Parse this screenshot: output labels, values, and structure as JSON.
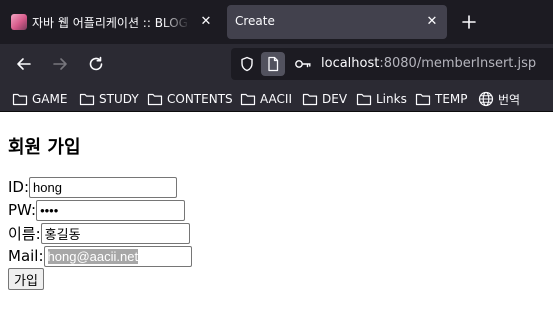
{
  "browser": {
    "tabs": [
      {
        "title": "자바 웹 어플리케이션 :: BLOG.AACII.NET",
        "active": false
      },
      {
        "title": "Create",
        "active": true
      }
    ],
    "url": {
      "host": "localhost",
      "rest": ":8080/memberInsert.jsp"
    },
    "bookmarks": [
      {
        "label": "GAME",
        "icon": "folder-icon"
      },
      {
        "label": "STUDY",
        "icon": "folder-icon"
      },
      {
        "label": "CONTENTS",
        "icon": "folder-icon"
      },
      {
        "label": "AACII",
        "icon": "folder-icon"
      },
      {
        "label": "DEV",
        "icon": "folder-icon"
      },
      {
        "label": "Links",
        "icon": "folder-icon"
      },
      {
        "label": "TEMP",
        "icon": "folder-icon"
      },
      {
        "label": "번역",
        "icon": "globe-icon"
      }
    ]
  },
  "page": {
    "title": "회원 가입",
    "form": {
      "id_label": "ID:",
      "id_value": "hong",
      "pw_label": "PW:",
      "pw_value": "1234",
      "name_label": "이름:",
      "name_value": "홍길동",
      "mail_label": "Mail:",
      "mail_value": "hong@aacii.net",
      "submit_label": "가입"
    }
  },
  "colors": {
    "tabstrip_bg": "#1c1b22",
    "toolbar_bg": "#2b2a33",
    "active_tab_bg": "#42414d"
  }
}
